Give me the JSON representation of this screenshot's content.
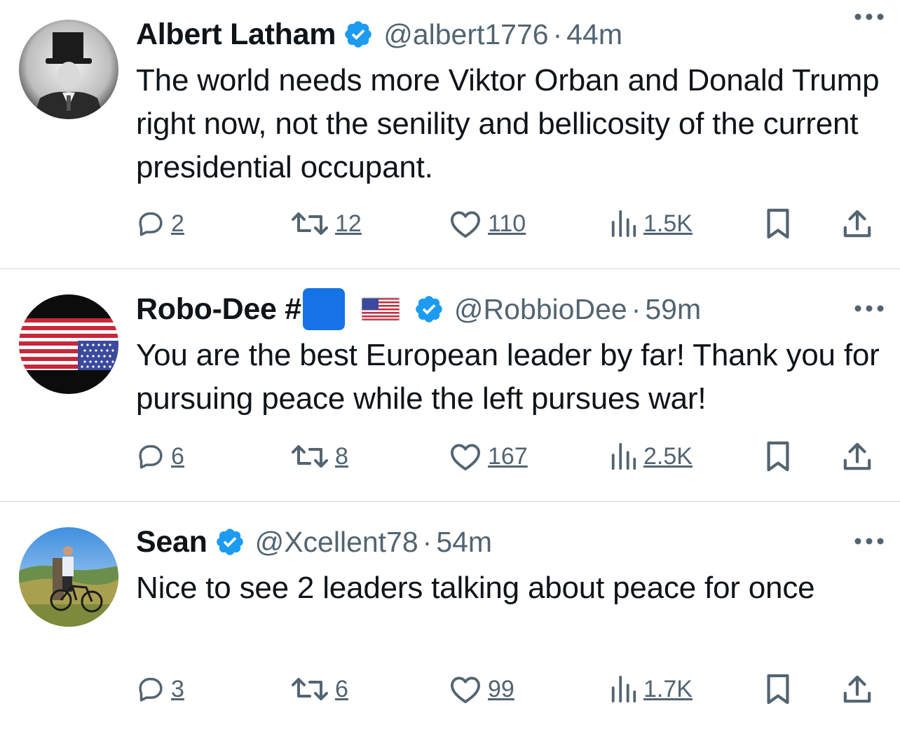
{
  "tweets": [
    {
      "name": "Albert Latham",
      "handle": "@albert1776",
      "separator": "·",
      "time": "44m",
      "text": "The world needs more Viktor Orban and Donald Trump right now, not the senility and bellicosity of the current presidential occupant.",
      "replies": "2",
      "retweets": "12",
      "likes": "110",
      "views": "1.5K"
    },
    {
      "name": "Robo-Dee #",
      "name_emojis": [
        "blue-square",
        "us-flag"
      ],
      "handle": "@RobbioDee",
      "separator": "·",
      "time": "59m",
      "text": "You are the best European leader by far! Thank you for pursuing peace while the left pursues war!",
      "replies": "6",
      "retweets": "8",
      "likes": "167",
      "views": "2.5K"
    },
    {
      "name": "Sean",
      "handle": "@Xcellent78",
      "separator": "·",
      "time": "54m",
      "text": "Nice to see 2 leaders talking about peace for once",
      "replies": "3",
      "retweets": "6",
      "likes": "99",
      "views": "1.7K"
    }
  ],
  "icons": {
    "verified": "verified-badge-icon",
    "more": "more-dots-icon",
    "reply": "reply-bubble-icon",
    "retweet": "retweet-arrows-icon",
    "like": "heart-icon",
    "views": "views-bars-icon",
    "bookmark": "bookmark-icon",
    "share": "share-upload-icon"
  },
  "colors": {
    "text": "#0f1419",
    "secondary": "#536471",
    "verified": "#1d9bf0",
    "divider": "#cfd9de"
  }
}
